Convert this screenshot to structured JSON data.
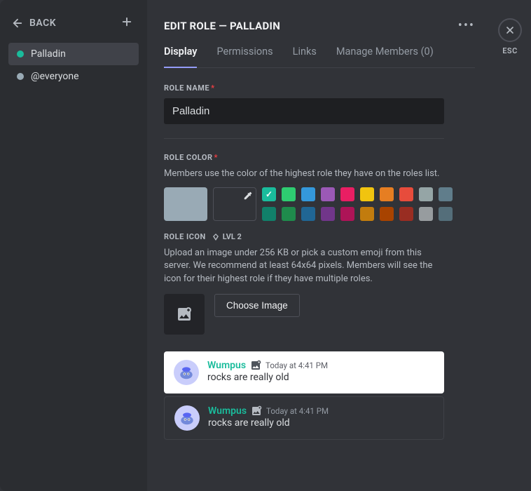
{
  "sidebar": {
    "back_label": "BACK",
    "roles": [
      {
        "name": "Palladin",
        "color": "#1abc9c",
        "selected": true
      },
      {
        "name": "@everyone",
        "color": "#99aab5",
        "selected": false
      }
    ]
  },
  "header": {
    "title": "EDIT ROLE — PALLADIN",
    "esc_label": "ESC"
  },
  "tabs": [
    {
      "label": "Display",
      "active": true
    },
    {
      "label": "Permissions",
      "active": false
    },
    {
      "label": "Links",
      "active": false
    },
    {
      "label": "Manage Members (0)",
      "active": false
    }
  ],
  "role_name": {
    "label": "ROLE NAME",
    "value": "Palladin"
  },
  "role_color": {
    "label": "ROLE COLOR",
    "help": "Members use the color of the highest role they have on the roles list.",
    "default_swatch": "#99aab5",
    "swatches_row1": [
      "#1abc9c",
      "#2ecc71",
      "#3498db",
      "#9b59b6",
      "#e91e63",
      "#f1c40f",
      "#e67e22",
      "#e74c3c",
      "#95a5a6",
      "#607d8b"
    ],
    "swatches_row2": [
      "#11806a",
      "#1f8b4c",
      "#206694",
      "#71368a",
      "#ad1457",
      "#c27c0e",
      "#a84300",
      "#992d22",
      "#979c9f",
      "#546e7a"
    ],
    "selected": "#1abc9c"
  },
  "role_icon": {
    "label": "ROLE ICON",
    "badge": "LVL 2",
    "help": "Upload an image under 256 KB or pick a custom emoji from this server. We recommend at least 64x64 pixels. Members will see the icon for their highest role if they have multiple roles.",
    "choose_label": "Choose Image"
  },
  "preview": {
    "username": "Wumpus",
    "timestamp": "Today at 4:41 PM",
    "message": "rocks are really old"
  }
}
